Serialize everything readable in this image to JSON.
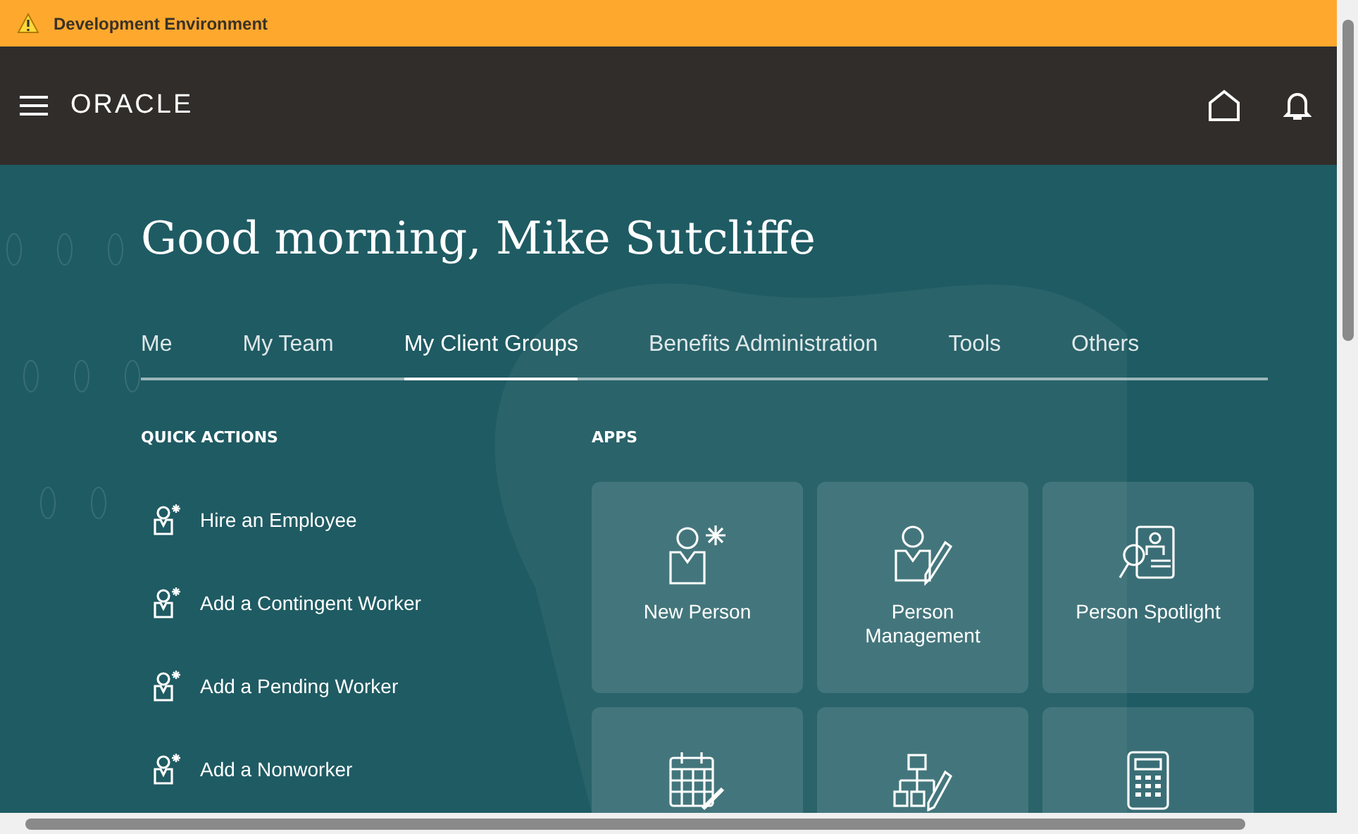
{
  "banner": {
    "text": "Development Environment"
  },
  "header": {
    "logo": "ORACLE"
  },
  "greeting": "Good morning, Mike Sutcliffe",
  "tabs": [
    {
      "label": "Me",
      "selected": false
    },
    {
      "label": "My Team",
      "selected": false
    },
    {
      "label": "My Client Groups",
      "selected": true
    },
    {
      "label": "Benefits Administration",
      "selected": false
    },
    {
      "label": "Tools",
      "selected": false
    },
    {
      "label": "Others",
      "selected": false
    }
  ],
  "quick_actions": {
    "title": "QUICK ACTIONS",
    "items": [
      "Hire an Employee",
      "Add a Contingent Worker",
      "Add a Pending Worker",
      "Add a Nonworker"
    ]
  },
  "apps": {
    "title": "APPS",
    "tiles": [
      {
        "kind": "full",
        "label": "New Person"
      },
      {
        "kind": "full",
        "label": "Person Management"
      },
      {
        "kind": "full",
        "label": "Person Spotlight"
      },
      {
        "kind": "cut"
      },
      {
        "kind": "cut"
      },
      {
        "kind": "cut"
      }
    ]
  }
}
